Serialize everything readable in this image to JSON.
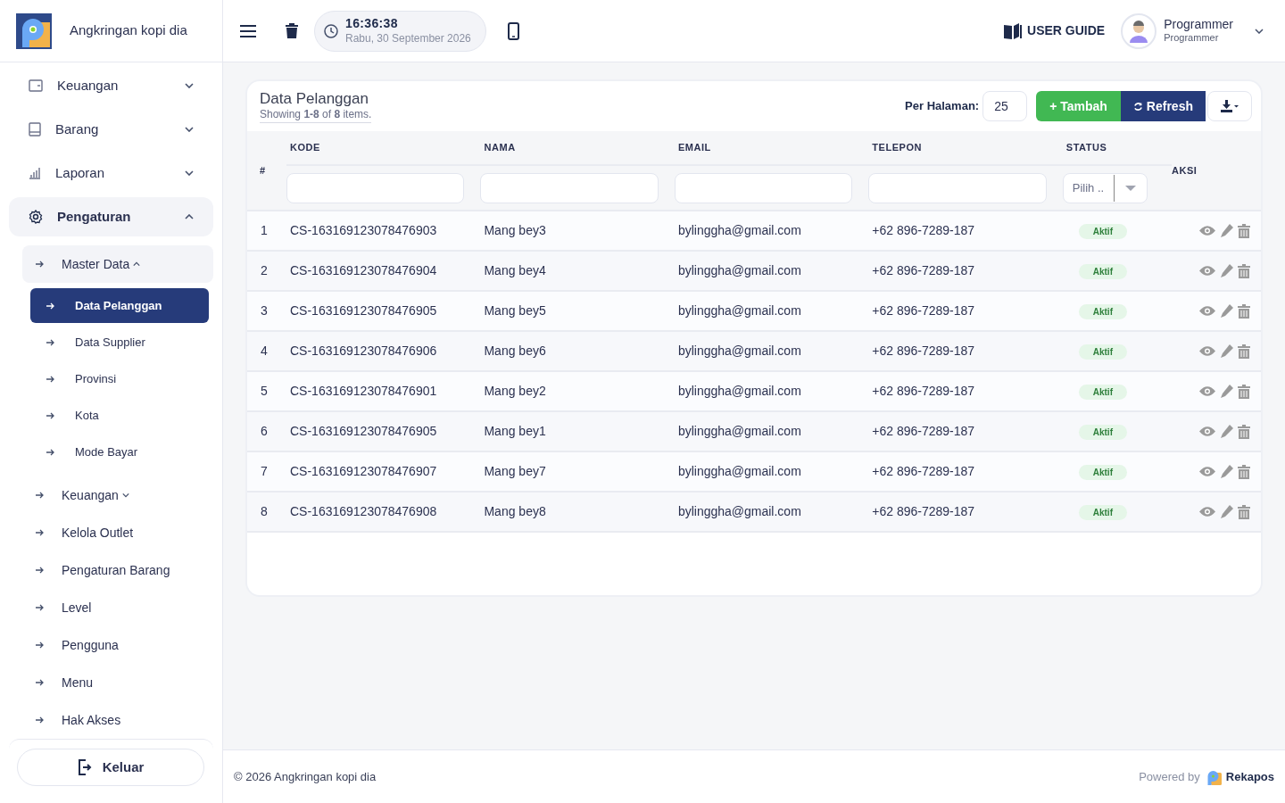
{
  "brand": {
    "name": "Angkringan kopi dia"
  },
  "header": {
    "time": "16:36:38",
    "date": "Rabu, 30 September 2026",
    "user_guide": "USER GUIDE",
    "user": {
      "name": "Programmer",
      "role": "Programmer"
    }
  },
  "sidebar": {
    "items": [
      {
        "label": "Keuangan",
        "expanded": false,
        "selected": false
      },
      {
        "label": "Barang",
        "expanded": false,
        "selected": false
      },
      {
        "label": "Laporan",
        "expanded": false,
        "selected": false
      },
      {
        "label": "Pengaturan",
        "expanded": true,
        "selected": false,
        "children": [
          {
            "label": "Master Data",
            "expanded": true,
            "selected": false,
            "children": [
              {
                "label": "Data Pelanggan",
                "selected": true
              },
              {
                "label": "Data Supplier",
                "selected": false
              },
              {
                "label": "Provinsi",
                "selected": false
              },
              {
                "label": "Kota",
                "selected": false
              },
              {
                "label": "Mode Bayar",
                "selected": false
              }
            ]
          },
          {
            "label": "Keuangan",
            "expanded": false,
            "selected": false
          },
          {
            "label": "Kelola Outlet",
            "selected": false
          },
          {
            "label": "Pengaturan Barang",
            "selected": false
          },
          {
            "label": "Level",
            "selected": false
          },
          {
            "label": "Pengguna",
            "selected": false
          },
          {
            "label": "Menu",
            "selected": false
          },
          {
            "label": "Hak Akses",
            "selected": false
          }
        ]
      }
    ],
    "logout": "Keluar"
  },
  "card": {
    "title": "Data Pelanggan",
    "summary": "Showing **1-8** of **8** items.",
    "per_page_label": "Per Halaman:",
    "per_page": "25",
    "add_button": "+ Tambah",
    "refresh_button": "Refresh"
  },
  "table": {
    "columns": [
      "#",
      "KODE",
      "NAMA",
      "EMAIL",
      "TELEPON",
      "STATUS",
      "AKSI"
    ],
    "status_placeholder": "Pilih ..",
    "rows": [
      {
        "no": "1",
        "kode": "CS-163169123078476903",
        "nama": "Mang bey3",
        "email": "bylinggha@gmail.com",
        "telepon": "+62 896-7289-187",
        "status": "Aktif"
      },
      {
        "no": "2",
        "kode": "CS-163169123078476904",
        "nama": "Mang bey4",
        "email": "bylinggha@gmail.com",
        "telepon": "+62 896-7289-187",
        "status": "Aktif"
      },
      {
        "no": "3",
        "kode": "CS-163169123078476905",
        "nama": "Mang bey5",
        "email": "bylinggha@gmail.com",
        "telepon": "+62 896-7289-187",
        "status": "Aktif"
      },
      {
        "no": "4",
        "kode": "CS-163169123078476906",
        "nama": "Mang bey6",
        "email": "bylinggha@gmail.com",
        "telepon": "+62 896-7289-187",
        "status": "Aktif"
      },
      {
        "no": "5",
        "kode": "CS-163169123078476901",
        "nama": "Mang bey2",
        "email": "bylinggha@gmail.com",
        "telepon": "+62 896-7289-187",
        "status": "Aktif"
      },
      {
        "no": "6",
        "kode": "CS-163169123078476905",
        "nama": "Mang bey1",
        "email": "bylinggha@gmail.com",
        "telepon": "+62 896-7289-187",
        "status": "Aktif"
      },
      {
        "no": "7",
        "kode": "CS-163169123078476907",
        "nama": "Mang bey7",
        "email": "bylinggha@gmail.com",
        "telepon": "+62 896-7289-187",
        "status": "Aktif"
      },
      {
        "no": "8",
        "kode": "CS-163169123078476908",
        "nama": "Mang bey8",
        "email": "bylinggha@gmail.com",
        "telepon": "+62 896-7289-187",
        "status": "Aktif"
      }
    ]
  },
  "footer": {
    "copyright": "© 2026 Angkringan kopi dia",
    "powered_by": "Powered by",
    "product": "Rekapos"
  }
}
